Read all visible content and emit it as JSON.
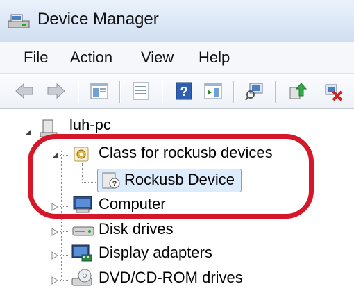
{
  "window": {
    "title": "Device Manager"
  },
  "menu": {
    "items": [
      "File",
      "Action",
      "View",
      "Help"
    ]
  },
  "toolbar": {
    "icons": [
      "back-arrow-icon",
      "forward-arrow-icon",
      "show-hide-console-tree-icon",
      "properties-icon",
      "help-icon",
      "action-pane-icon",
      "scan-hardware-icon",
      "update-driver-icon",
      "uninstall-icon"
    ]
  },
  "tree": {
    "root": {
      "label": "luh-pc"
    },
    "items": [
      {
        "label": "Class for rockusb devices",
        "expanded": true,
        "icon": "device-class-gear-icon"
      },
      {
        "label": "Rockusb Device",
        "icon": "unknown-device-icon",
        "selected": true
      },
      {
        "label": "Computer",
        "expanded": false,
        "icon": "computer-icon"
      },
      {
        "label": "Disk drives",
        "expanded": false,
        "icon": "disk-drive-icon"
      },
      {
        "label": "Display adapters",
        "expanded": false,
        "icon": "display-adapter-icon"
      },
      {
        "label": "DVD/CD-ROM drives",
        "expanded": false,
        "icon": "dvd-drive-icon"
      }
    ]
  },
  "annotation": {
    "color": "#d6172a"
  }
}
